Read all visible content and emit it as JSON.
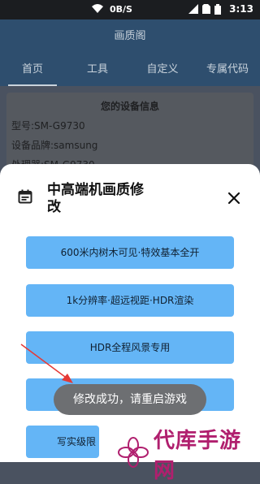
{
  "status_bar": {
    "net_speed": "0B/S",
    "time": "3:13"
  },
  "app_bar": {
    "title": "画质阁"
  },
  "tabs": [
    {
      "label": "首页",
      "active": true
    },
    {
      "label": "工具",
      "active": false
    },
    {
      "label": "自定义",
      "active": false
    },
    {
      "label": "专属代码",
      "active": false
    }
  ],
  "device_info": {
    "heading": "您的设备信息",
    "model": "型号:SM-G9730",
    "brand": "设备品牌:samsung",
    "processor": "处理器:SM-G9730"
  },
  "sheet": {
    "title": "中高端机画质修改",
    "options": [
      "600米内树木可见·特效基本全开",
      "1k分辨率·超远视距·HDR渲染",
      "HDR全程风景专用",
      "",
      "写实级限"
    ]
  },
  "toast": {
    "message": "修改成功，请重启游戏"
  },
  "watermark": {
    "text": "代库手游网"
  },
  "colors": {
    "accent": "#64b5f6",
    "app_bar": "#2e4e6e",
    "watermark": "#b01f6e"
  }
}
